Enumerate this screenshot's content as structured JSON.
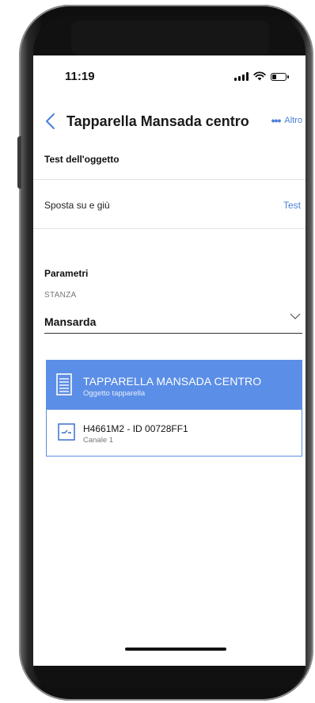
{
  "status_bar": {
    "time": "11:19",
    "battery_level": 0.35
  },
  "header": {
    "back_icon": "chevron-left-icon",
    "title": "Tapparella Mansada centro",
    "more_icon": "ellipsis-icon",
    "more_label": "Altro"
  },
  "test_section": {
    "title": "Test dell'oggetto",
    "row_label": "Sposta su e giù",
    "row_action": "Test"
  },
  "params_section": {
    "title": "Parametri",
    "room_label": "STANZA",
    "room_value": "Mansarda"
  },
  "device_card": {
    "head_title": "TAPPARELLA MANSADA CENTRO",
    "head_subtitle": "Oggetto tapparella",
    "head_icon": "shutter-icon",
    "item_title": "H4661M2 - ID 00728FF1",
    "item_subtitle": "Canale 1",
    "item_icon": "switch-module-icon"
  },
  "colors": {
    "accent": "#4a7fd8",
    "card_header": "#5b8ee6"
  }
}
